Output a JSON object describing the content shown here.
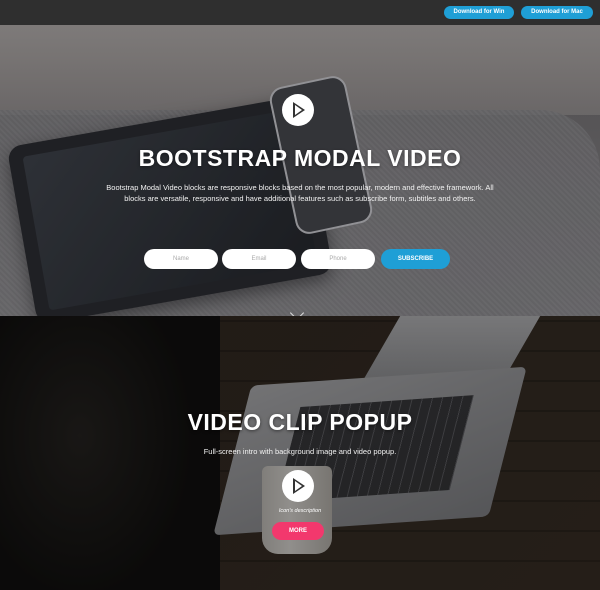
{
  "topbar": {
    "download_windows": "Download for Win",
    "download_mac": "Download for Mac"
  },
  "hero1": {
    "title": "BOOTSTRAP MODAL VIDEO",
    "description": "Bootstrap Modal Video blocks are responsive blocks based on the most popular, modern and effective framework. All blocks are versatile, responsive and have additional features such as subscribe form, subtitles and others.",
    "form": {
      "name_placeholder": "Name",
      "email_placeholder": "Email",
      "phone_placeholder": "Phone",
      "submit_label": "SUBSCRIBE"
    }
  },
  "hero2": {
    "title": "VIDEO CLIP POPUP",
    "description": "Full-screen intro with background image and video popup.",
    "icon_caption": "Icon's description",
    "button_label": "MORE"
  },
  "colors": {
    "accent_blue": "#1f9fd6",
    "accent_pink": "#f2386d",
    "topbar_bg": "#2f2f2f"
  }
}
